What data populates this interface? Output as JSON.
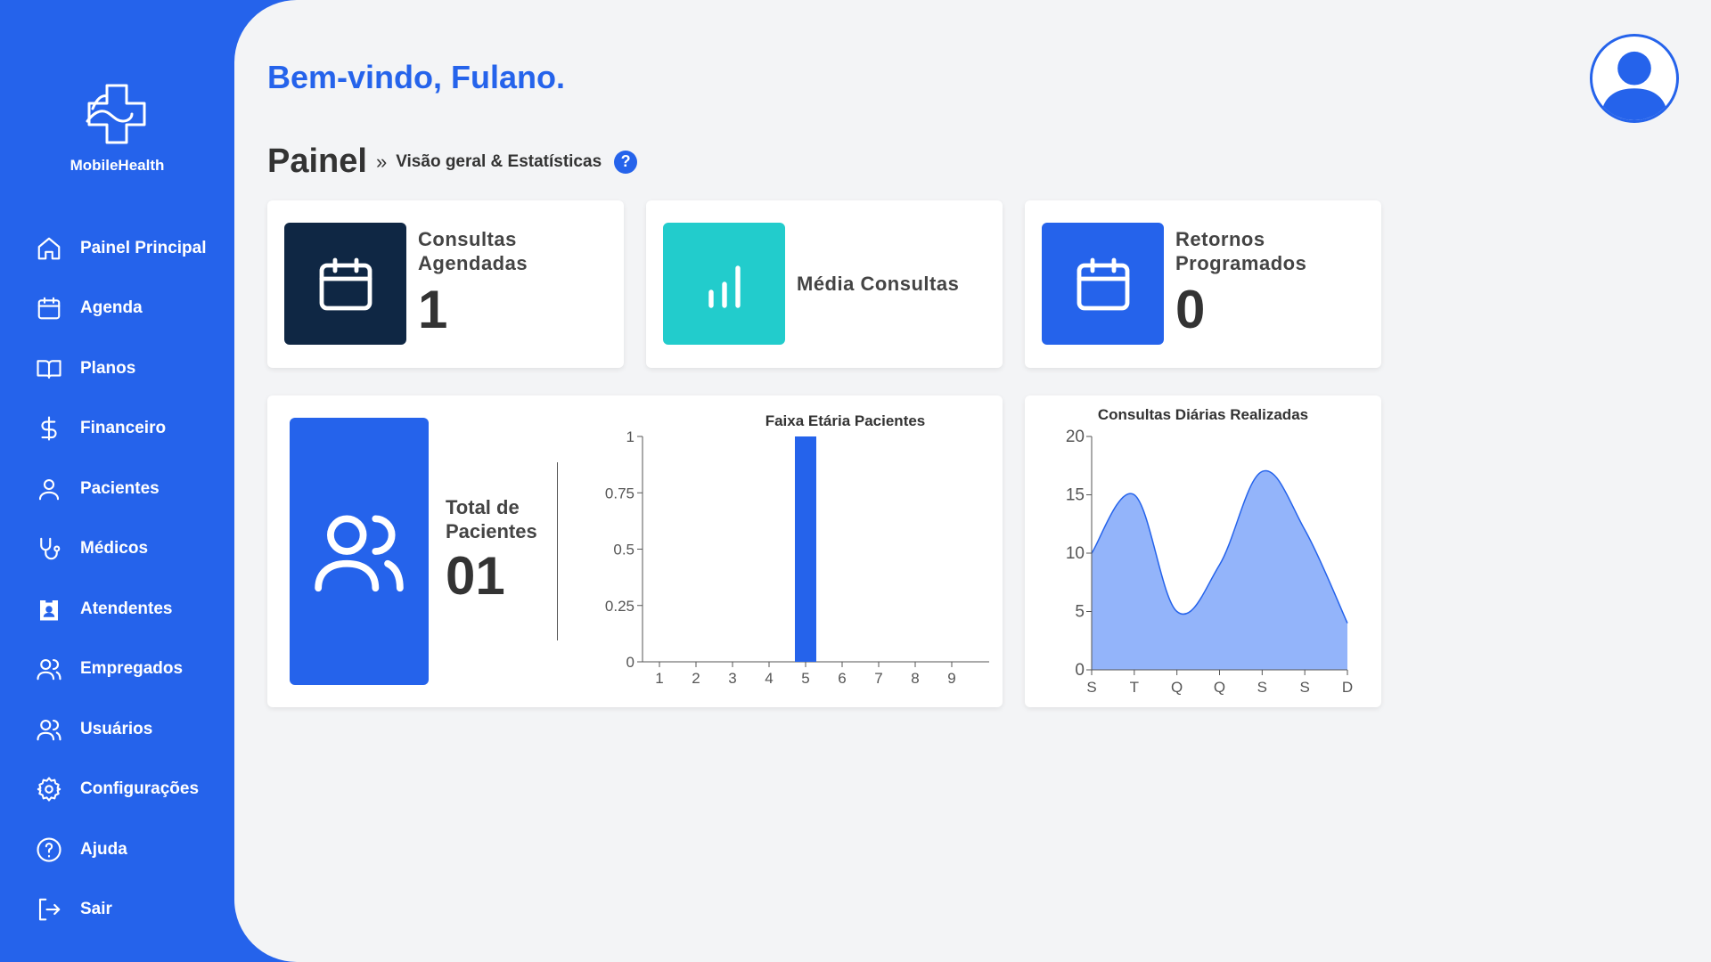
{
  "brand": {
    "name": "MobileHealth"
  },
  "sidebar": {
    "items": [
      {
        "label": "Painel Principal",
        "icon": "home-icon"
      },
      {
        "label": "Agenda",
        "icon": "calendar-icon"
      },
      {
        "label": "Planos",
        "icon": "book-icon"
      },
      {
        "label": "Financeiro",
        "icon": "dollar-icon"
      },
      {
        "label": "Pacientes",
        "icon": "user-icon"
      },
      {
        "label": "Médicos",
        "icon": "stethoscope-icon"
      },
      {
        "label": "Atendentes",
        "icon": "badge-icon"
      },
      {
        "label": "Empregados",
        "icon": "users-icon"
      },
      {
        "label": "Usuários",
        "icon": "users-icon"
      },
      {
        "label": "Configurações",
        "icon": "gear-icon"
      },
      {
        "label": "Ajuda",
        "icon": "help-icon"
      },
      {
        "label": "Sair",
        "icon": "logout-icon"
      }
    ]
  },
  "header": {
    "welcome": "Bem-vindo, Fulano.",
    "title": "Painel",
    "separator": "»",
    "subtitle": "Visão geral & Estatísticas",
    "help": "?"
  },
  "stats": {
    "consultas": {
      "label_line1": "Consultas",
      "label_line2": "Agendadas",
      "value": "1",
      "color": "#0f2744"
    },
    "media": {
      "label": "Média Consultas",
      "color": "#22cccc"
    },
    "retornos": {
      "label_line1": "Retornos",
      "label_line2": "Programados",
      "value": "0",
      "color": "#2563eb"
    }
  },
  "patients": {
    "label_line1": "Total de",
    "label_line2": "Pacientes",
    "value": "01"
  },
  "colors": {
    "primary": "#2563eb",
    "area_fill": "#93b4fa",
    "area_line": "#2563eb"
  },
  "chart_data": [
    {
      "type": "bar",
      "title": "Faixa Etária Pacientes",
      "categories": [
        "1",
        "2",
        "3",
        "4",
        "5",
        "6",
        "7",
        "8",
        "9"
      ],
      "values": [
        0,
        0,
        0,
        0,
        1,
        0,
        0,
        0,
        0
      ],
      "ylim": [
        0,
        1
      ],
      "yticks": [
        "0",
        "0.25",
        "0.5",
        "0.75",
        "1"
      ],
      "xlabel": "",
      "ylabel": ""
    },
    {
      "type": "area",
      "title": "Consultas Diárias Realizadas",
      "categories": [
        "S",
        "T",
        "Q",
        "Q",
        "S",
        "S",
        "D"
      ],
      "values": [
        10,
        15,
        5,
        9,
        17,
        12,
        4
      ],
      "ylim": [
        0,
        20
      ],
      "yticks": [
        "0",
        "5",
        "10",
        "15",
        "20"
      ],
      "xlabel": "",
      "ylabel": ""
    }
  ]
}
